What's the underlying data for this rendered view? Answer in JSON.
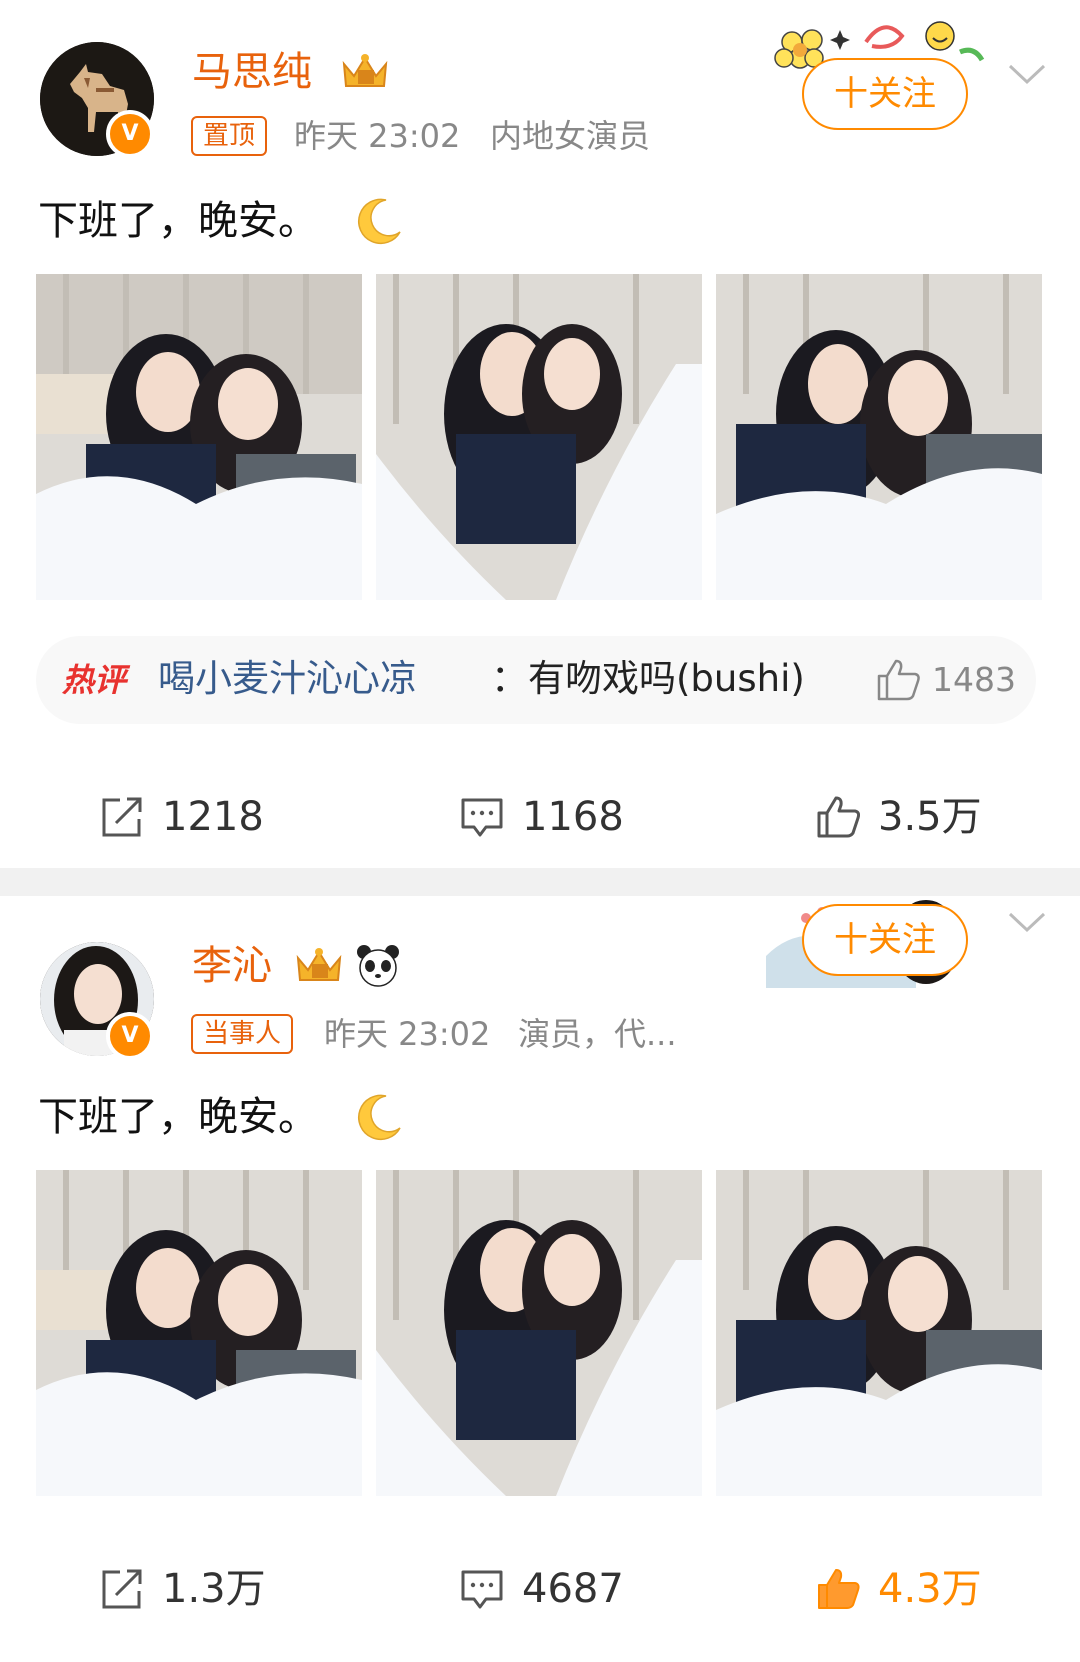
{
  "posts": [
    {
      "user": "马思纯",
      "tag": "置顶",
      "time": "昨天 23:02",
      "desc": "内地女演员",
      "follow": "十关注",
      "text": "下班了，晚安。",
      "hot_comment": {
        "label": "热评",
        "user": "喝小麦汁沁心凉",
        "text": "：有吻戏吗(bushi)",
        "likes": "1483"
      },
      "reposts": "1218",
      "comments": "1168",
      "likes": "3.5万",
      "liked": false
    },
    {
      "user": "李沁",
      "tag": "当事人",
      "time": "昨天 23:02",
      "desc": "演员，代...",
      "follow": "十关注",
      "text": "下班了，晚安。",
      "reposts": "1.3万",
      "comments": "4687",
      "likes": "4.3万",
      "liked": true
    }
  ],
  "colors": {
    "username": "#e8620c",
    "follow": "#ff8a00",
    "hot_label": "#e8322f",
    "comment_user": "#375b8c",
    "liked": "#ff8a00",
    "meta": "#888888"
  },
  "icons": [
    "crown-badge-icon",
    "panda-icon",
    "moon-emoji-icon",
    "verified-v-icon",
    "chevron-down-icon",
    "repost-icon",
    "comment-icon",
    "like-icon"
  ]
}
